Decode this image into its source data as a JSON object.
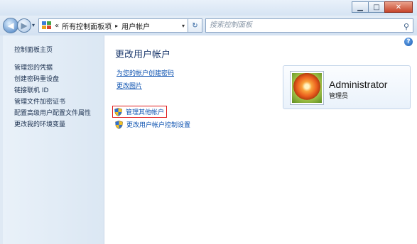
{
  "window": {
    "minimize_label": "▁",
    "maximize_label": "□",
    "close_label": "✕"
  },
  "nav": {
    "back_icon": "◀",
    "forward_icon": "▶",
    "recent_icon": "▾",
    "breadcrumb": {
      "overflow": "«",
      "items": [
        "所有控制面板项",
        "用户帐户"
      ],
      "separator": "▸"
    },
    "dropdown_icon": "▾",
    "refresh_icon": "↻",
    "search_placeholder": "搜索控制面板",
    "search_icon": "⚲"
  },
  "sidebar": {
    "home_label": "控制面板主页",
    "items": [
      {
        "label": "管理您的凭据"
      },
      {
        "label": "创建密码重设盘"
      },
      {
        "label": "链接联机 ID"
      },
      {
        "label": "管理文件加密证书"
      },
      {
        "label": "配置高级用户配置文件属性"
      },
      {
        "label": "更改我的环境变量"
      }
    ]
  },
  "main": {
    "help_icon": "?",
    "title": "更改用户帐户",
    "links": [
      {
        "label": "为您的帐户创建密码"
      },
      {
        "label": "更改图片"
      }
    ],
    "admin_links": [
      {
        "label": "管理其他帐户",
        "highlighted": true
      },
      {
        "label": "更改用户帐户控制设置",
        "highlighted": false
      }
    ],
    "account": {
      "name": "Administrator",
      "role": "管理员"
    }
  },
  "colors": {
    "link": "#0b51b0",
    "title": "#1e3b6e",
    "highlight_border": "#e01b1b"
  }
}
